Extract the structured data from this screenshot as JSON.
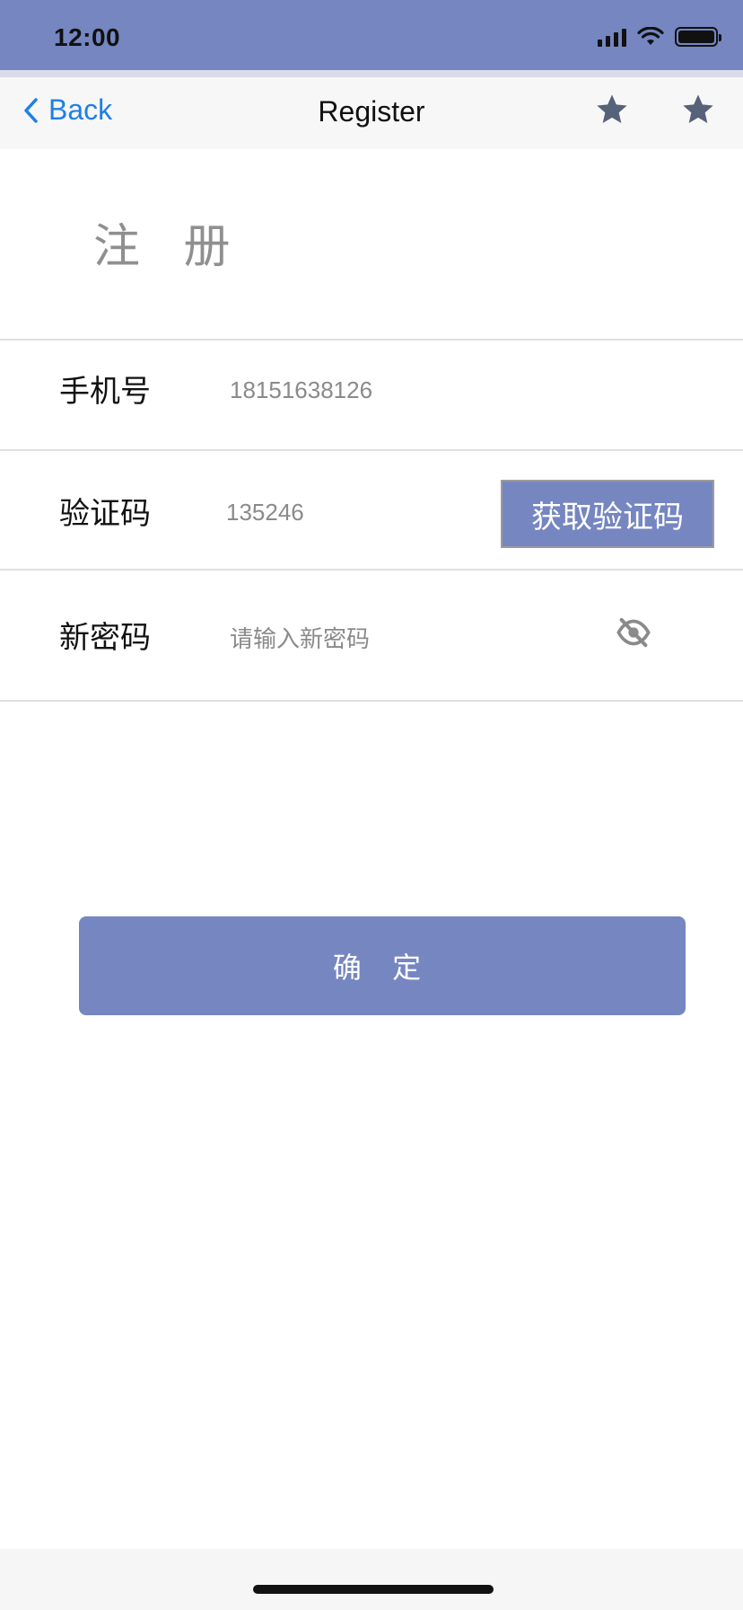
{
  "status_bar": {
    "time": "12:00",
    "icons": [
      "signal-icon",
      "wifi-icon",
      "battery-icon"
    ],
    "background": "#7586c1"
  },
  "nav": {
    "back_label": "Back",
    "title": "Register",
    "actions": [
      "star-icon",
      "star-icon"
    ],
    "accent": "#1e80e5"
  },
  "page": {
    "heading": "注 册"
  },
  "form": {
    "phone": {
      "label": "手机号",
      "value": "18151638126"
    },
    "code": {
      "label": "验证码",
      "value": "135246",
      "button_label": "获取验证码"
    },
    "password": {
      "label": "新密码",
      "placeholder": "请输入新密码",
      "toggle_icon": "eye-off-icon"
    }
  },
  "confirm": {
    "label": "确 定"
  },
  "theme": {
    "primary": "#7586c1",
    "star": "#56617a"
  }
}
